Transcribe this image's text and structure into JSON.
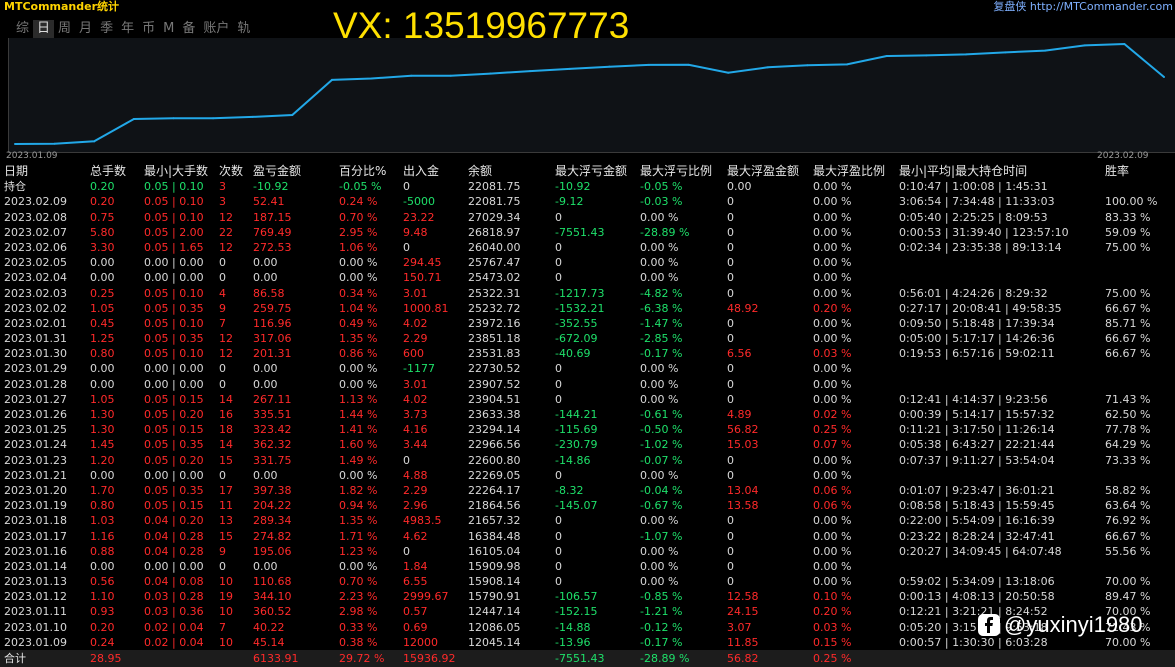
{
  "app": {
    "title": "MTCommander统计",
    "link": "复盘侠 http://MTCommander.com"
  },
  "watermark": "VX:  13519967773",
  "tabs": [
    {
      "label": "综",
      "active": false
    },
    {
      "label": "日",
      "active": true
    },
    {
      "label": "周",
      "active": false
    },
    {
      "label": "月",
      "active": false
    },
    {
      "label": "季",
      "active": false
    },
    {
      "label": "年",
      "active": false
    },
    {
      "label": "币",
      "active": false
    },
    {
      "label": "M",
      "active": false
    },
    {
      "label": "备",
      "active": false
    },
    {
      "label": "账户",
      "active": false
    },
    {
      "label": "轨",
      "active": false
    }
  ],
  "chart_data": {
    "type": "line",
    "x_start": "2023.01.09",
    "x_end": "2023.02.09",
    "x": [
      "2023.01.09",
      "2023.01.10",
      "2023.01.11",
      "2023.01.12",
      "2023.01.13",
      "2023.01.14",
      "2023.01.16",
      "2023.01.17",
      "2023.01.18",
      "2023.01.19",
      "2023.01.20",
      "2023.01.21",
      "2023.01.23",
      "2023.01.24",
      "2023.01.25",
      "2023.01.26",
      "2023.01.27",
      "2023.01.28",
      "2023.01.29",
      "2023.01.30",
      "2023.01.31",
      "2023.02.01",
      "2023.02.02",
      "2023.02.03",
      "2023.02.04",
      "2023.02.05",
      "2023.02.06",
      "2023.02.07",
      "2023.02.08",
      "2023.02.09"
    ],
    "y": [
      12045.14,
      12086.05,
      12447.14,
      15790.91,
      15908.14,
      15909.98,
      16105.04,
      16384.48,
      21657.32,
      21864.56,
      22264.17,
      22269.05,
      22600.8,
      22966.56,
      23294.14,
      23633.38,
      23904.51,
      23907.52,
      22730.52,
      23531.83,
      23851.18,
      23972.16,
      25232.72,
      25322.31,
      25473.02,
      25767.47,
      26040.0,
      26818.97,
      27029.34,
      22081.75
    ],
    "color": "#22a8e8"
  },
  "table": {
    "headers": [
      "日期",
      "总手数",
      "最小|大手数",
      "次数",
      "盈亏金额",
      "百分比%",
      "出入金",
      "余额",
      "最大浮亏金额",
      "最大浮亏比例",
      "最大浮盈金额",
      "最大浮盈比例",
      "最小|平均|最大持仓时间",
      "胜率"
    ],
    "rows": [
      [
        "持仓",
        "0.20",
        "0.05 | 0.10",
        "3",
        "-10.92",
        "-0.05 %",
        "0",
        "22081.75",
        "-10.92",
        "-0.05 %",
        "0.00",
        "0.00 %",
        "0:10:47 | 1:00:08 | 1:45:31",
        ""
      ],
      [
        "2023.02.09",
        "0.20",
        "0.05 | 0.10",
        "3",
        "52.41",
        "0.24 %",
        "-5000",
        "22081.75",
        "-9.12",
        "-0.03 %",
        "0",
        "0.00 %",
        "3:06:54 | 7:34:48 | 11:33:03",
        "100.00 %"
      ],
      [
        "2023.02.08",
        "0.75",
        "0.05 | 0.10",
        "12",
        "187.15",
        "0.70 %",
        "23.22",
        "27029.34",
        "0",
        "0.00 %",
        "0",
        "0.00 %",
        "0:05:40 | 2:25:25 | 8:09:53",
        "83.33 %"
      ],
      [
        "2023.02.07",
        "5.80",
        "0.05 | 2.00",
        "22",
        "769.49",
        "2.95 %",
        "9.48",
        "26818.97",
        "-7551.43",
        "-28.89 %",
        "0",
        "0.00 %",
        "0:00:53 | 31:39:40 | 123:57:10",
        "59.09 %"
      ],
      [
        "2023.02.06",
        "3.30",
        "0.05 | 1.65",
        "12",
        "272.53",
        "1.06 %",
        "0",
        "26040.00",
        "0",
        "0.00 %",
        "0",
        "0.00 %",
        "0:02:34 | 23:35:38 | 89:13:14",
        "75.00 %"
      ],
      [
        "2023.02.05",
        "0.00",
        "0.00 | 0.00",
        "0",
        "0.00",
        "0.00 %",
        "294.45",
        "25767.47",
        "0",
        "0.00 %",
        "0",
        "0.00 %",
        "",
        ""
      ],
      [
        "2023.02.04",
        "0.00",
        "0.00 | 0.00",
        "0",
        "0.00",
        "0.00 %",
        "150.71",
        "25473.02",
        "0",
        "0.00 %",
        "0",
        "0.00 %",
        "",
        ""
      ],
      [
        "2023.02.03",
        "0.25",
        "0.05 | 0.10",
        "4",
        "86.58",
        "0.34 %",
        "3.01",
        "25322.31",
        "-1217.73",
        "-4.82 %",
        "0",
        "0.00 %",
        "0:56:01 | 4:24:26 | 8:29:32",
        "75.00 %"
      ],
      [
        "2023.02.02",
        "1.05",
        "0.05 | 0.35",
        "9",
        "259.75",
        "1.04 %",
        "1000.81",
        "25232.72",
        "-1532.21",
        "-6.38 %",
        "48.92",
        "0.20 %",
        "0:27:17 | 20:08:41 | 49:58:35",
        "66.67 %"
      ],
      [
        "2023.02.01",
        "0.45",
        "0.05 | 0.10",
        "7",
        "116.96",
        "0.49 %",
        "4.02",
        "23972.16",
        "-352.55",
        "-1.47 %",
        "0",
        "0.00 %",
        "0:09:50 | 5:18:48 | 17:39:34",
        "85.71 %"
      ],
      [
        "2023.01.31",
        "1.25",
        "0.05 | 0.35",
        "12",
        "317.06",
        "1.35 %",
        "2.29",
        "23851.18",
        "-672.09",
        "-2.85 %",
        "0",
        "0.00 %",
        "0:05:00 | 5:17:17 | 14:26:36",
        "66.67 %"
      ],
      [
        "2023.01.30",
        "0.80",
        "0.05 | 0.10",
        "12",
        "201.31",
        "0.86 %",
        "600",
        "23531.83",
        "-40.69",
        "-0.17 %",
        "6.56",
        "0.03 %",
        "0:19:53 | 6:57:16 | 59:02:11",
        "66.67 %"
      ],
      [
        "2023.01.29",
        "0.00",
        "0.00 | 0.00",
        "0",
        "0.00",
        "0.00 %",
        "-1177",
        "22730.52",
        "0",
        "0.00 %",
        "0",
        "0.00 %",
        "",
        ""
      ],
      [
        "2023.01.28",
        "0.00",
        "0.00 | 0.00",
        "0",
        "0.00",
        "0.00 %",
        "3.01",
        "23907.52",
        "0",
        "0.00 %",
        "0",
        "0.00 %",
        "",
        ""
      ],
      [
        "2023.01.27",
        "1.05",
        "0.05 | 0.15",
        "14",
        "267.11",
        "1.13 %",
        "4.02",
        "23904.51",
        "0",
        "0.00 %",
        "0",
        "0.00 %",
        "0:12:41 | 4:14:37 | 9:23:56",
        "71.43 %"
      ],
      [
        "2023.01.26",
        "1.30",
        "0.05 | 0.20",
        "16",
        "335.51",
        "1.44 %",
        "3.73",
        "23633.38",
        "-144.21",
        "-0.61 %",
        "4.89",
        "0.02 %",
        "0:00:39 | 5:14:17 | 15:57:32",
        "62.50 %"
      ],
      [
        "2023.01.25",
        "1.30",
        "0.05 | 0.15",
        "18",
        "323.42",
        "1.41 %",
        "4.16",
        "23294.14",
        "-115.69",
        "-0.50 %",
        "56.82",
        "0.25 %",
        "0:11:21 | 3:17:50 | 11:26:14",
        "77.78 %"
      ],
      [
        "2023.01.24",
        "1.45",
        "0.05 | 0.35",
        "14",
        "362.32",
        "1.60 %",
        "3.44",
        "22966.56",
        "-230.79",
        "-1.02 %",
        "15.03",
        "0.07 %",
        "0:05:38 | 6:43:27 | 22:21:44",
        "64.29 %"
      ],
      [
        "2023.01.23",
        "1.20",
        "0.05 | 0.20",
        "15",
        "331.75",
        "1.49 %",
        "0",
        "22600.80",
        "-14.86",
        "-0.07 %",
        "0",
        "0.00 %",
        "0:07:37 | 9:11:27 | 53:54:04",
        "73.33 %"
      ],
      [
        "2023.01.21",
        "0.00",
        "0.00 | 0.00",
        "0",
        "0.00",
        "0.00 %",
        "4.88",
        "22269.05",
        "0",
        "0.00 %",
        "0",
        "0.00 %",
        "",
        ""
      ],
      [
        "2023.01.20",
        "1.70",
        "0.05 | 0.35",
        "17",
        "397.38",
        "1.82 %",
        "2.29",
        "22264.17",
        "-8.32",
        "-0.04 %",
        "13.04",
        "0.06 %",
        "0:01:07 | 9:23:47 | 36:01:21",
        "58.82 %"
      ],
      [
        "2023.01.19",
        "0.80",
        "0.05 | 0.15",
        "11",
        "204.22",
        "0.94 %",
        "2.96",
        "21864.56",
        "-145.07",
        "-0.67 %",
        "13.58",
        "0.06 %",
        "0:08:58 | 5:18:43 | 15:59:45",
        "63.64 %"
      ],
      [
        "2023.01.18",
        "1.03",
        "0.04 | 0.20",
        "13",
        "289.34",
        "1.35 %",
        "4983.5",
        "21657.32",
        "0",
        "0.00 %",
        "0",
        "0.00 %",
        "0:22:00 | 5:54:09 | 16:16:39",
        "76.92 %"
      ],
      [
        "2023.01.17",
        "1.16",
        "0.04 | 0.28",
        "15",
        "274.82",
        "1.71 %",
        "4.62",
        "16384.48",
        "0",
        "-1.07 %",
        "0",
        "0.00 %",
        "0:23:22 | 8:28:24 | 32:47:41",
        "66.67 %"
      ],
      [
        "2023.01.16",
        "0.88",
        "0.04 | 0.28",
        "9",
        "195.06",
        "1.23 %",
        "0",
        "16105.04",
        "0",
        "0.00 %",
        "0",
        "0.00 %",
        "0:20:27 | 34:09:45 | 64:07:48",
        "55.56 %"
      ],
      [
        "2023.01.14",
        "0.00",
        "0.00 | 0.00",
        "0",
        "0.00",
        "0.00 %",
        "1.84",
        "15909.98",
        "0",
        "0.00 %",
        "0",
        "0.00 %",
        "",
        ""
      ],
      [
        "2023.01.13",
        "0.56",
        "0.04 | 0.08",
        "10",
        "110.68",
        "0.70 %",
        "6.55",
        "15908.14",
        "0",
        "0.00 %",
        "0",
        "0.00 %",
        "0:59:02 | 5:34:09 | 13:18:06",
        "70.00 %"
      ],
      [
        "2023.01.12",
        "1.10",
        "0.03 | 0.28",
        "19",
        "344.10",
        "2.23 %",
        "2999.67",
        "15790.91",
        "-106.57",
        "-0.85 %",
        "12.58",
        "0.10 %",
        "0:00:13 | 4:08:13 | 20:50:58",
        "89.47 %"
      ],
      [
        "2023.01.11",
        "0.93",
        "0.03 | 0.36",
        "10",
        "360.52",
        "2.98 %",
        "0.57",
        "12447.14",
        "-152.15",
        "-1.21 %",
        "24.15",
        "0.20 %",
        "0:12:21 | 3:21:21 | 8:24:52",
        "70.00 %"
      ],
      [
        "2023.01.10",
        "0.20",
        "0.02 | 0.04",
        "7",
        "40.22",
        "0.33 %",
        "0.69",
        "12086.05",
        "-14.88",
        "-0.12 %",
        "3.07",
        "0.03 %",
        "0:05:20 | 3:15:59 | 9:53:18",
        "71.43 %"
      ],
      [
        "2023.01.09",
        "0.24",
        "0.02 | 0.04",
        "10",
        "45.14",
        "0.38 %",
        "12000",
        "12045.14",
        "-13.96",
        "-0.17 %",
        "11.85",
        "0.15 %",
        "0:00:57 | 1:30:30 | 6:03:28",
        "70.00 %"
      ]
    ],
    "footer": [
      "合计",
      "28.95",
      "",
      "",
      "6133.91",
      "29.72 %",
      "15936.92",
      "",
      "-7551.43",
      "-28.89 %",
      "56.82",
      "0.25 %",
      "",
      ""
    ]
  },
  "colors": {
    "positive": "#ff2a2a",
    "negative": "#1ee06a",
    "neutral": "#d8d8d8",
    "title": "#ffd400",
    "line": "#22a8e8"
  },
  "social": {
    "icon": "facebook-icon",
    "handle": "@yuxinyi1980"
  }
}
